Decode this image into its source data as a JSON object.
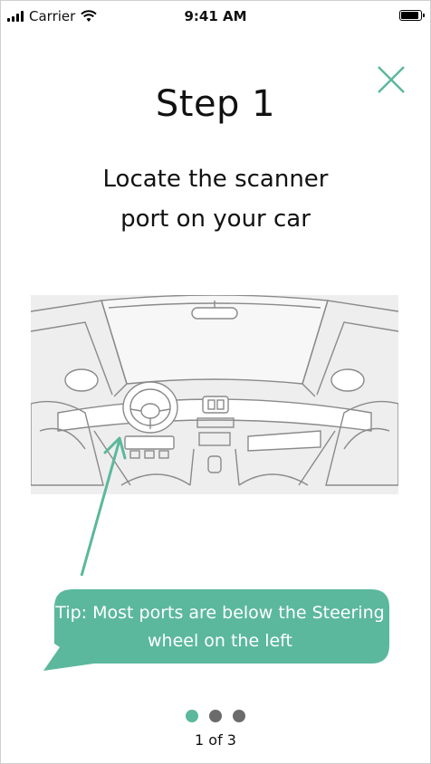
{
  "status_bar": {
    "carrier": "Carrier",
    "time": "9:41 AM",
    "battery_level": 1.0
  },
  "step": {
    "title": "Step 1",
    "instruction": "Locate the scanner port on your car"
  },
  "tip": {
    "text": "Tip: Most ports are below the Steering wheel on the left"
  },
  "pager": {
    "current": 1,
    "total": 3,
    "label": "1 of 3"
  },
  "colors": {
    "accent": "#5bb89c",
    "dot_inactive": "#6b6b6b",
    "text": "#111111"
  },
  "icons": {
    "close": "close-icon",
    "wifi": "wifi-icon",
    "signal": "signal-icon",
    "battery": "battery-icon"
  }
}
